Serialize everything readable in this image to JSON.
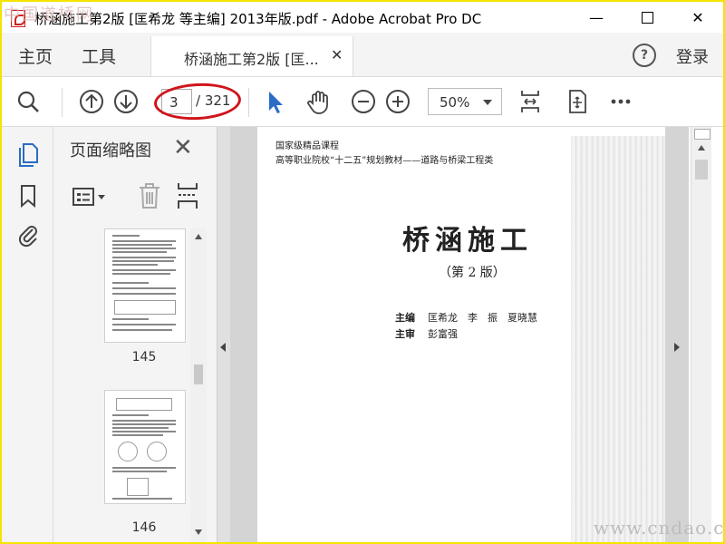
{
  "window": {
    "title": "桥涵施工第2版 [匡希龙 等主编] 2013年版.pdf - Adobe Acrobat Pro DC",
    "watermark_top": "中国道桥网",
    "watermark_bottom": "www.cndao.com"
  },
  "tabs": {
    "home": "主页",
    "tools": "工具",
    "document": "桥涵施工第2版 [匡...",
    "help": "?",
    "login": "登录"
  },
  "toolbar": {
    "current_page": "3",
    "total_pages": "/ 321",
    "zoom": "50%"
  },
  "panel": {
    "title": "页面缩略图",
    "thumbnails": [
      {
        "label": "145"
      },
      {
        "label": "146"
      }
    ]
  },
  "document": {
    "line1": "国家级精品课程",
    "line2": "高等职业院校“十二五”规划教材——道路与桥梁工程类",
    "title": "桥涵施工",
    "edition": "（第 2 版）",
    "editor_role": "主编",
    "editors": "匡希龙　李　振　夏晓慧",
    "reviewer_role": "主审",
    "reviewer": "彭富强"
  },
  "colors": {
    "accent_blue": "#2b6cc4",
    "highlight_red": "#d0141b",
    "frame_yellow": "#f5e400"
  }
}
